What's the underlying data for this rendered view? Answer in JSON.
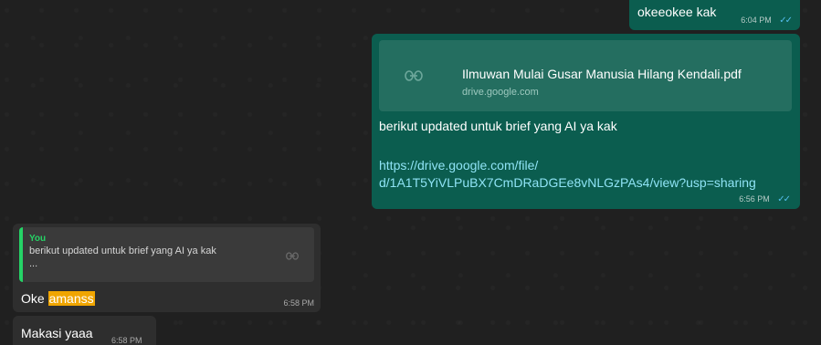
{
  "messages": [
    {
      "direction": "outgoing",
      "text": "okeeokee kak",
      "time": "6:04 PM",
      "status": "read"
    },
    {
      "direction": "outgoing",
      "link_preview": {
        "title": "Ilmuwan Mulai Gusar Manusia Hilang Kendali.pdf",
        "domain": "drive.google.com"
      },
      "text": "berikut updated untuk brief yang AI ya kak",
      "url_line1": "https://drive.google.com/file/",
      "url_line2": "d/1A1T5YiVLPuBX7CmDRaDGEe8vNLGzPAs4/view?usp=sharing",
      "time": "6:56 PM",
      "status": "read"
    },
    {
      "direction": "incoming",
      "quoted": {
        "author": "You",
        "text": "berikut updated untuk brief yang AI ya kak",
        "ellipsis": "..."
      },
      "text_plain": "Oke",
      "text_highlight": "amanss",
      "time": "6:58 PM"
    },
    {
      "direction": "incoming",
      "text": "Makasi yaaa",
      "time": "6:58 PM"
    }
  ],
  "icons": {
    "read_ticks": "✓✓",
    "link": "⊖"
  },
  "colors": {
    "outgoing_bubble": "#0b5d4f",
    "incoming_bubble": "#2e2e2e",
    "quote_accent": "#25d366",
    "search_highlight": "#f0a500",
    "link_color": "#8fe3f5",
    "read_ticks": "#53bdeb"
  }
}
